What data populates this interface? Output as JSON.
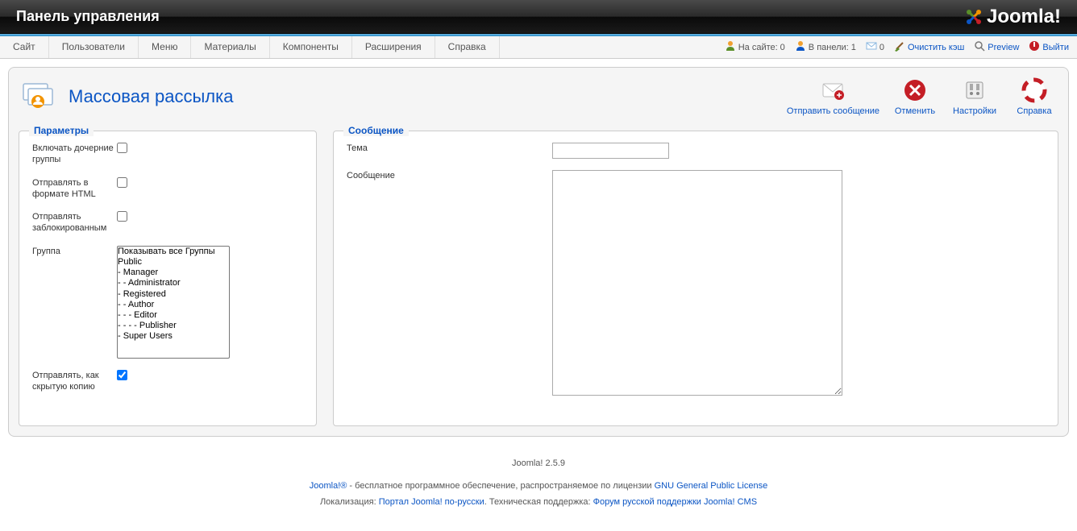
{
  "header": {
    "title": "Панель управления",
    "logo_text": "Joomla!"
  },
  "menu": {
    "items": [
      "Сайт",
      "Пользователи",
      "Меню",
      "Материалы",
      "Компоненты",
      "Расширения",
      "Справка"
    ]
  },
  "status": {
    "visitors_label": "На сайте:",
    "visitors_count": "0",
    "admins_label": "В панели:",
    "admins_count": "1",
    "messages_count": "0",
    "clear_cache": "Очистить кэш",
    "preview": "Preview",
    "logout": "Выйти"
  },
  "page": {
    "title": "Массовая рассылка"
  },
  "toolbar": {
    "send": "Отправить сообщение",
    "cancel": "Отменить",
    "options": "Настройки",
    "help": "Справка"
  },
  "params": {
    "legend": "Параметры",
    "recurse_label": "Включать дочерние группы",
    "html_label": "Отправлять в формате HTML",
    "disabled_label": "Отправлять заблокированным",
    "group_label": "Группа",
    "bcc_label": "Отправлять, как скрытую копию",
    "groups": [
      "Показывать все Группы",
      "Public",
      "- Manager",
      "- - Administrator",
      "- Registered",
      "- - Author",
      "- - - Editor",
      "- - - - Publisher",
      "- Super Users"
    ]
  },
  "message": {
    "legend": "Сообщение",
    "subject_label": "Тема",
    "body_label": "Сообщение"
  },
  "footer": {
    "version": "Joomla! 2.5.9",
    "line1_pre": "Joomla!®",
    "line1_text": " - бесплатное программное обеспечение, распространяемое по лицензии ",
    "line1_link": "GNU General Public License",
    "line2_loc": "Локализация: ",
    "line2_link1": "Портал Joomla! по-русски",
    "line2_mid": ". Техническая поддержка: ",
    "line2_link2": "Форум русской поддержки Joomla! CMS"
  }
}
